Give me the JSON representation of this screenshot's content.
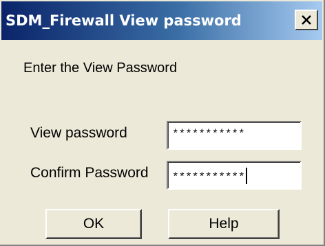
{
  "window": {
    "title": "SDM_Firewall View password",
    "close_icon": "close-icon"
  },
  "prompt": "Enter the View Password",
  "fields": {
    "view_password": {
      "label": "View password",
      "value": "***********"
    },
    "confirm_password": {
      "label": "Confirm Password",
      "value": "***********"
    }
  },
  "buttons": {
    "ok": "OK",
    "help": "Help"
  },
  "colors": {
    "title_gradient_start": "#0a246a",
    "title_gradient_end": "#a6caf0",
    "dialog_face": "#ece9d8"
  }
}
